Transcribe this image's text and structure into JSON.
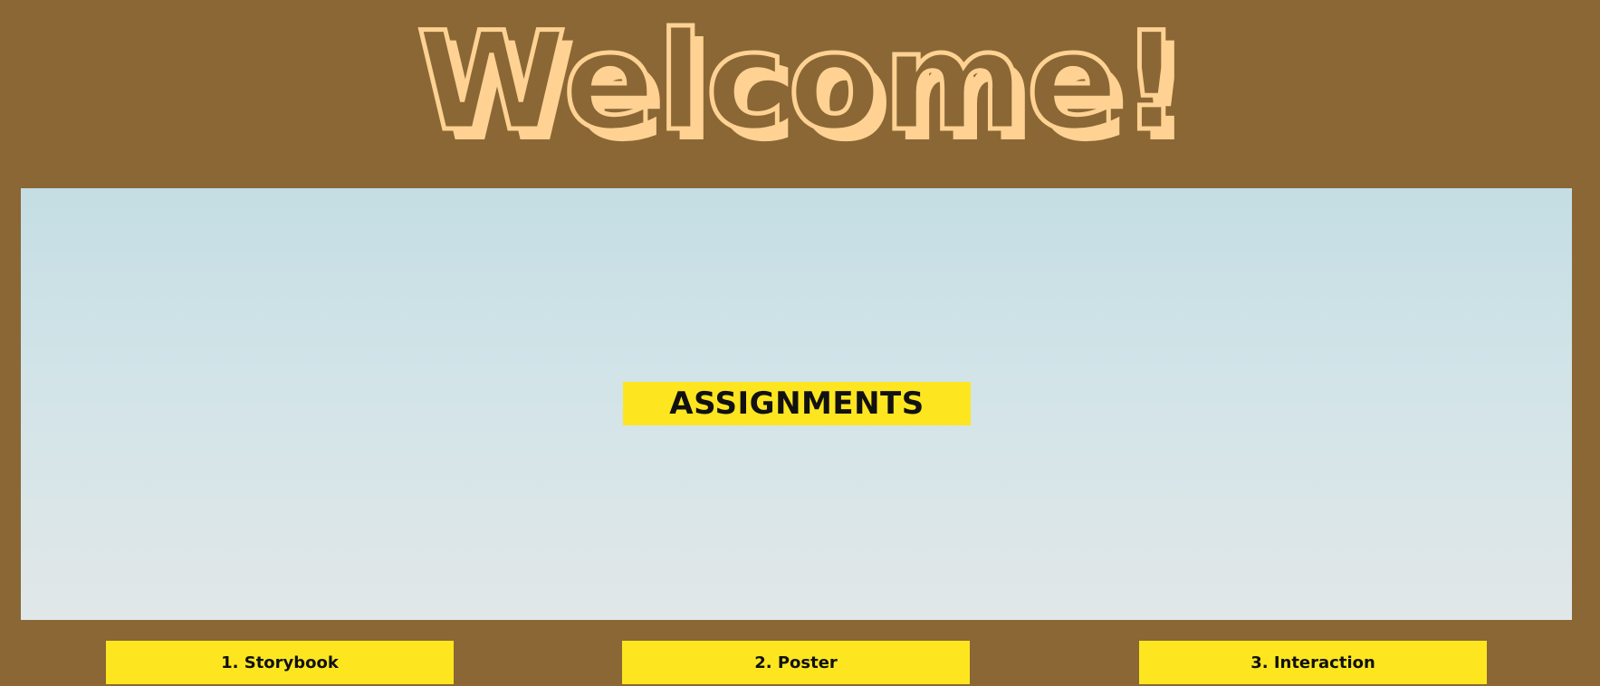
{
  "header": {
    "title": "Welcome!"
  },
  "main": {
    "assignments_label": "ASSIGNMENTS"
  },
  "nav": {
    "items": [
      {
        "label": "1. Storybook"
      },
      {
        "label": "2. Poster"
      },
      {
        "label": "3. Interaction"
      }
    ]
  },
  "colors": {
    "background": "#8a6735",
    "title_fill": "#ffd293",
    "button": "#fde620",
    "panel_top": "#c4dee4",
    "panel_bottom": "#e1e7e8"
  }
}
